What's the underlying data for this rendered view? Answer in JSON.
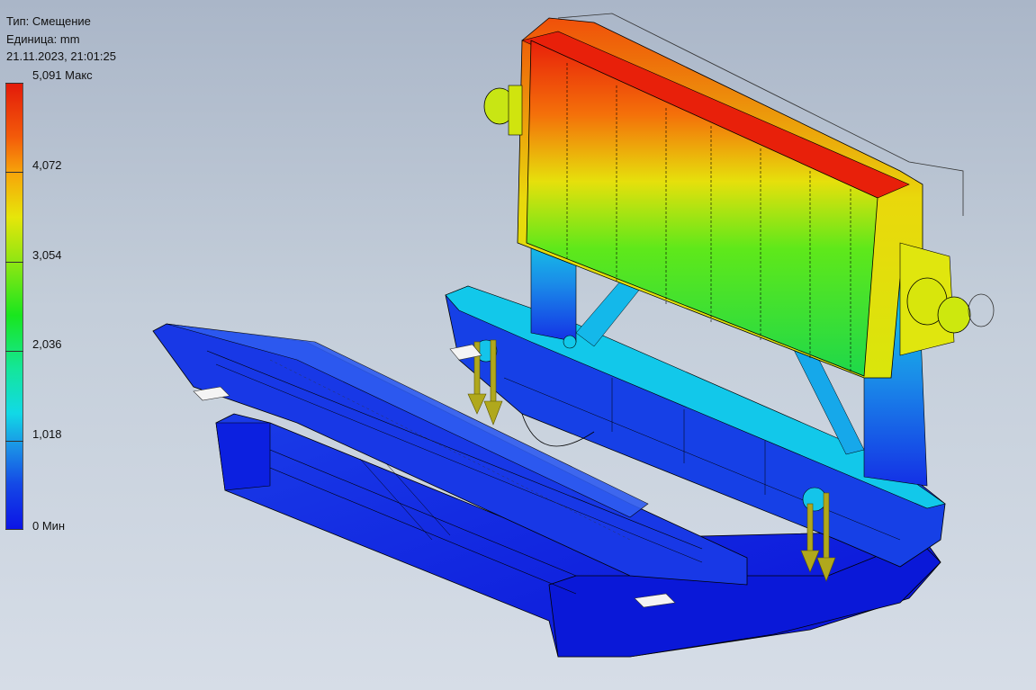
{
  "header": {
    "type_line": "Тип: Смещение",
    "unit_line": "Единица: mm",
    "timestamp": "21.11.2023, 21:01:25"
  },
  "legend": {
    "labels": [
      "5,091 Макс",
      "4,072",
      "3,054",
      "2,036",
      "1,018",
      "0 Мин"
    ],
    "max": 5.091,
    "min": 0,
    "unit": "mm"
  },
  "colors": {
    "blue": "#0a1ee6",
    "cyan": "#12d8ea",
    "green": "#22dd22",
    "yellow": "#e8e80c",
    "orange": "#f7960a",
    "red": "#e3240a",
    "load_arrow": "#b0a81c",
    "background": "#c4ceda"
  }
}
